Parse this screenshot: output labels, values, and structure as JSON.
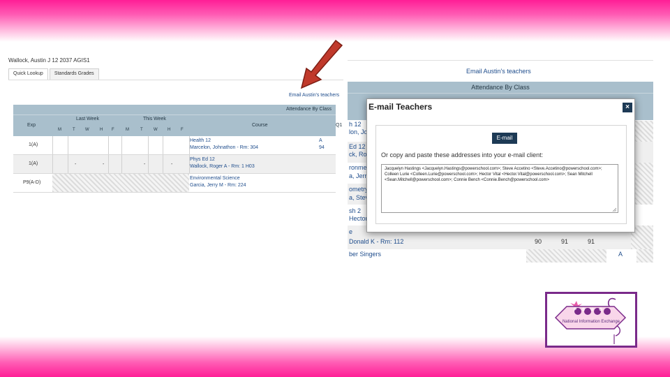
{
  "student_header": "Wallock, Austin J   12   2037     AGIS1",
  "tabs": [
    {
      "label": "Quick Lookup"
    },
    {
      "label": "Standards Grades"
    }
  ],
  "email_link": "Email Austin's teachers",
  "left_table": {
    "title": "Attendance By Class",
    "col_exp": "Exp",
    "col_last_week": "Last Week",
    "col_this_week": "This Week",
    "col_course": "Course",
    "days": [
      "M",
      "T",
      "W",
      "H",
      "F"
    ],
    "rows": [
      {
        "exp": "1(A)",
        "course": "Health 12",
        "teacher": "Marcelon, Johnathon - Rm: 304",
        "grade": "A",
        "pct": "94"
      },
      {
        "exp": "1(A)",
        "course": "Phys Ed 12",
        "teacher": "Wallock, Roger A - Rm: 1 H03",
        "grade": "",
        "pct": ""
      },
      {
        "exp": "P9(A-D)",
        "course": "Environmental Science",
        "teacher": "Garcia, Jerry M - Rm: 224",
        "grade": "",
        "pct": ""
      }
    ],
    "col_q1": "Q1"
  },
  "right_panel": {
    "email_link": "Email Austin's teachers",
    "title": "Attendance By Class",
    "partial_rows": [
      {
        "line1": "h 12",
        "line2": "lon, Jo"
      },
      {
        "line1": "Ed 12",
        "line2": "ck, Rog"
      },
      {
        "line1": "ronment",
        "line2": "a, Jerry"
      },
      {
        "line1": "ometry",
        "line2": "a, Steve"
      },
      {
        "line1": "sh 2",
        "line2": "Hector"
      },
      {
        "line1": "e",
        "line2": "Donald K - Rm: 112"
      },
      {
        "line1": "ber Singers",
        "line2": ""
      }
    ],
    "scores": [
      "90",
      "91",
      "91"
    ],
    "grade_a": "A"
  },
  "modal": {
    "title": "E-mail Teachers",
    "close": "×",
    "email_button": "E-mail",
    "copy_text": "Or copy and paste these addresses into your e-mail client:",
    "addresses": "Jacquelyn Hastings <Jacquelyn.Hastings@powerschool.com>; Steve Accetino <Steve.Accetino@powerschool.com>; Colleen Lurie <Colleen.Lurie@powerschool.com>; Hector Vital <Hector.Vital@powerschool.com>; Sean Mitchell <Sean.Mitchell@powerschool.com>; Connie Bench <Connie.Bench@powerschool.com>"
  },
  "logo": {
    "acronym": "PSUG",
    "subtitle": "National Information Exchange"
  },
  "colors": {
    "brand_pink": "#ff1e96",
    "table_header": "#a9bfcc",
    "button_navy": "#1d3a55",
    "link_blue": "#1f4d8c",
    "arrow_red": "#c0392b",
    "logo_purple": "#7a2a8a"
  }
}
